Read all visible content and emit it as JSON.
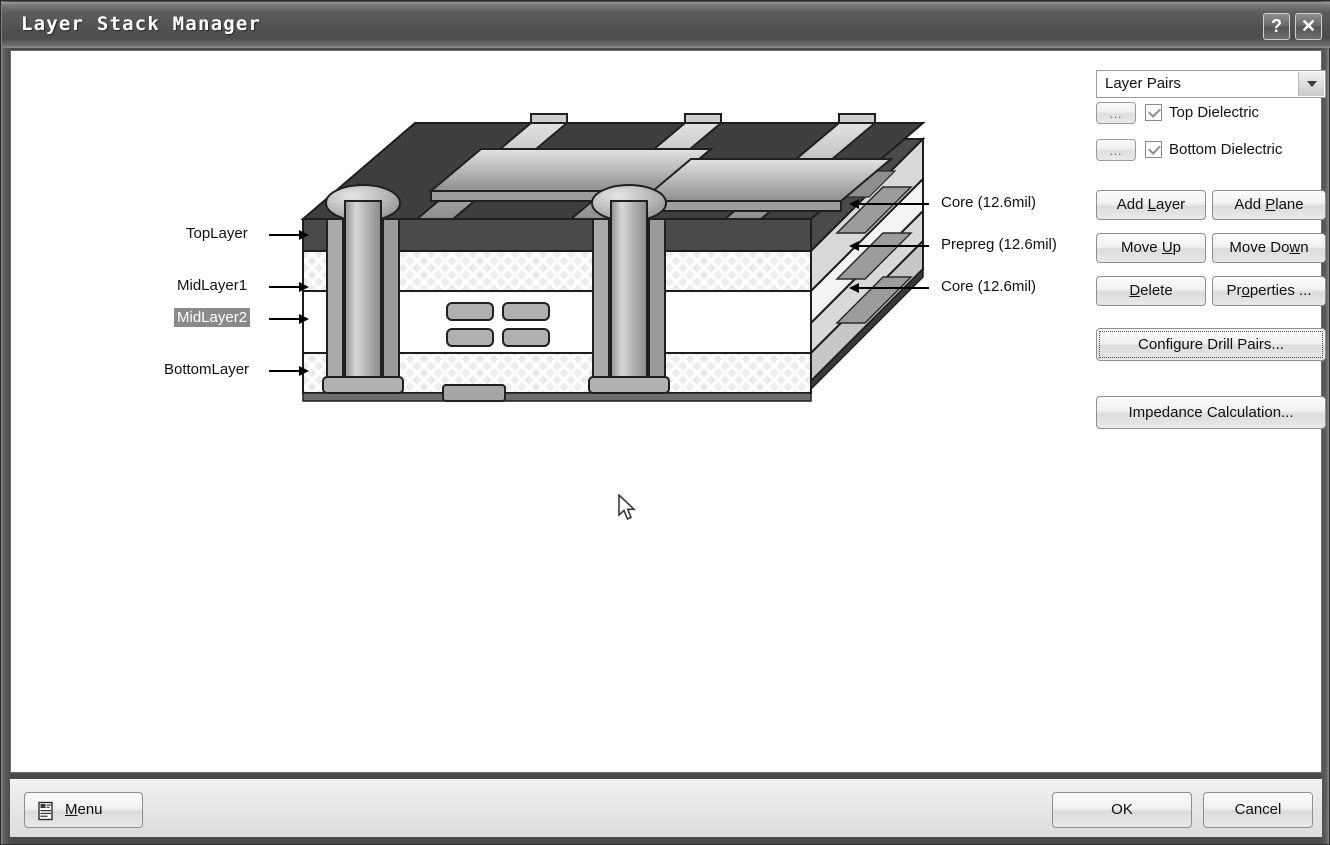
{
  "window": {
    "title": "Layer Stack Manager",
    "help_button": "?",
    "close_button": "✕",
    "help_icon_name": "help-icon",
    "close_icon_name": "close-icon"
  },
  "panel": {
    "layer_pairs_select": {
      "value": "Layer Pairs",
      "options": [
        "Layer Pairs"
      ]
    },
    "dots_button_label": "...",
    "checkboxes": [
      {
        "label": "Top Dielectric",
        "checked": true
      },
      {
        "label": "Bottom Dielectric",
        "checked": true
      }
    ],
    "buttons": {
      "add_layer": "Add Layer",
      "add_layer_accel": "L",
      "add_plane": "Add Plane",
      "add_plane_accel": "P",
      "move_up": "Move Up",
      "move_up_accel": "U",
      "move_down": "Move Down",
      "move_down_accel": "w",
      "delete": "Delete",
      "delete_accel": "D",
      "properties": "Properties ...",
      "properties_accel": "o",
      "configure_drill_pairs": "Configure Drill Pairs...",
      "impedance_calculation": "Impedance Calculation..."
    }
  },
  "bottom_bar": {
    "menu": "Menu",
    "menu_accel": "M",
    "ok": "OK",
    "cancel": "Cancel"
  },
  "diagram": {
    "left_labels": [
      {
        "text": "TopLayer",
        "selected": false
      },
      {
        "text": "MidLayer1",
        "selected": false
      },
      {
        "text": "MidLayer2",
        "selected": true
      },
      {
        "text": "BottomLayer",
        "selected": false
      }
    ],
    "right_labels": [
      {
        "text": "Core (12.6mil)"
      },
      {
        "text": "Prepreg (12.6mil)"
      },
      {
        "text": "Core (12.6mil)"
      }
    ]
  },
  "colors": {
    "titlebar": "#545454",
    "copper_top": "#4a4a4a",
    "core_fill": "#e8e8e8",
    "prepreg_fill": "#ffffff",
    "metal": "#a8a8a8",
    "selection": "#8a8a8a"
  }
}
